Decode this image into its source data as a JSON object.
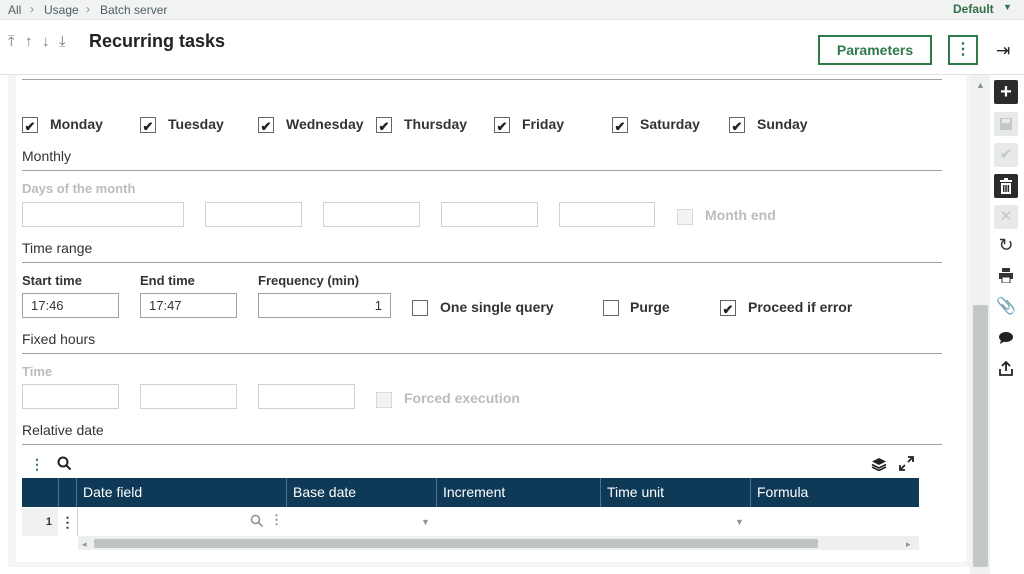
{
  "breadcrumb": [
    "All",
    "Usage",
    "Batch server"
  ],
  "folder": "Default",
  "page_title": "Recurring tasks",
  "header_actions": {
    "parameters_label": "Parameters"
  },
  "weekdays": [
    {
      "label": "Monday",
      "checked": true
    },
    {
      "label": "Tuesday",
      "checked": true
    },
    {
      "label": "Wednesday",
      "checked": true
    },
    {
      "label": "Thursday",
      "checked": true
    },
    {
      "label": "Friday",
      "checked": true
    },
    {
      "label": "Saturday",
      "checked": true
    },
    {
      "label": "Sunday",
      "checked": true
    }
  ],
  "monthly": {
    "section_title": "Monthly",
    "days_label": "Days of the month",
    "month_end_label": "Month end"
  },
  "time_range": {
    "section_title": "Time range",
    "start_time_label": "Start time",
    "start_time": "17:46",
    "end_time_label": "End time",
    "end_time": "17:47",
    "frequency_label": "Frequency (min)",
    "frequency": "1",
    "one_single_query_label": "One single query",
    "one_single_query": false,
    "purge_label": "Purge",
    "purge": false,
    "proceed_if_error_label": "Proceed if error",
    "proceed_if_error": true
  },
  "fixed_hours": {
    "section_title": "Fixed hours",
    "time_label": "Time",
    "forced_execution_label": "Forced execution"
  },
  "relative_date": {
    "section_title": "Relative date",
    "columns": [
      "Date field",
      "Base date",
      "Increment",
      "Time unit",
      "Formula"
    ],
    "rows": [
      {
        "num": "1"
      }
    ]
  },
  "icons": {
    "sidebar_tools": [
      "add-icon",
      "save-icon",
      "check-icon",
      "delete-icon",
      "cancel-icon",
      "refresh-icon",
      "print-icon",
      "attach-icon",
      "comment-icon",
      "export-icon"
    ]
  }
}
